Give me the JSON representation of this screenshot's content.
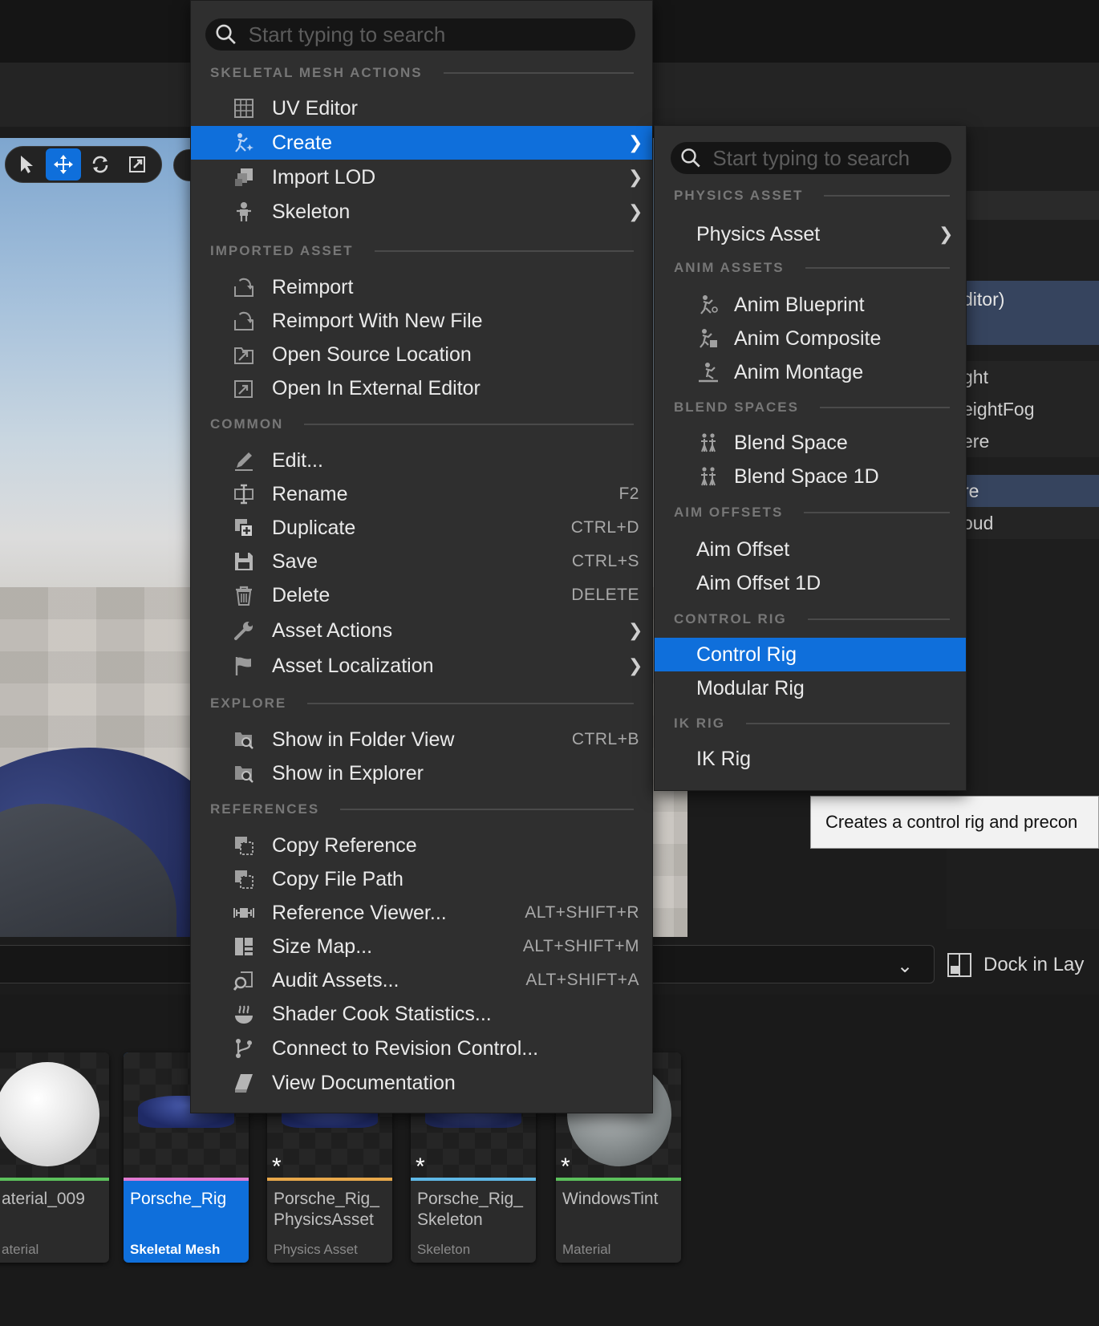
{
  "main_menu": {
    "search_placeholder": "Start typing to search",
    "sections": {
      "skeletal_mesh_actions": "SKELETAL MESH ACTIONS",
      "imported_asset": "IMPORTED ASSET",
      "common": "COMMON",
      "explore": "EXPLORE",
      "references": "REFERENCES"
    },
    "items": {
      "uv_editor": "UV Editor",
      "create": "Create",
      "import_lod": "Import LOD",
      "skeleton": "Skeleton",
      "reimport": "Reimport",
      "reimport_new_file": "Reimport With New File",
      "open_source_location": "Open Source Location",
      "open_external_editor": "Open In External Editor",
      "edit": "Edit...",
      "rename": "Rename",
      "duplicate": "Duplicate",
      "save": "Save",
      "delete": "Delete",
      "asset_actions": "Asset Actions",
      "asset_localization": "Asset Localization",
      "show_folder_view": "Show in Folder View",
      "show_explorer": "Show in Explorer",
      "copy_reference": "Copy Reference",
      "copy_file_path": "Copy File Path",
      "reference_viewer": "Reference Viewer...",
      "size_map": "Size Map...",
      "audit_assets": "Audit Assets...",
      "shader_cook_stats": "Shader Cook Statistics...",
      "connect_revision": "Connect to Revision Control...",
      "view_documentation": "View Documentation"
    },
    "shortcuts": {
      "rename": "F2",
      "duplicate": "CTRL+D",
      "save": "CTRL+S",
      "delete": "DELETE",
      "show_folder_view": "CTRL+B",
      "reference_viewer": "ALT+SHIFT+R",
      "size_map": "ALT+SHIFT+M",
      "audit_assets": "ALT+SHIFT+A"
    }
  },
  "create_submenu": {
    "search_placeholder": "Start typing to search",
    "sections": {
      "physics_asset": "PHYSICS ASSET",
      "anim_assets": "ANIM ASSETS",
      "blend_spaces": "BLEND SPACES",
      "aim_offsets": "AIM OFFSETS",
      "control_rig": "CONTROL RIG",
      "ik_rig": "IK RIG"
    },
    "items": {
      "physics_asset": "Physics Asset",
      "anim_blueprint": "Anim Blueprint",
      "anim_composite": "Anim Composite",
      "anim_montage": "Anim Montage",
      "blend_space": "Blend Space",
      "blend_space_1d": "Blend Space 1D",
      "aim_offset": "Aim Offset",
      "aim_offset_1d": "Aim Offset 1D",
      "control_rig": "Control Rig",
      "modular_rig": "Modular Rig",
      "ik_rig": "IK Rig"
    }
  },
  "tooltip": "Creates a control rig and precon",
  "outliner": {
    "rows": [
      "ditor)",
      "ght",
      "eightFog",
      "ere",
      "re",
      "oud"
    ]
  },
  "dock_label": "Dock in Lay",
  "assets": [
    {
      "name": "aterial_009",
      "type": "aterial"
    },
    {
      "name": "Porsche_Rig",
      "type": "Skeletal Mesh"
    },
    {
      "name": "Porsche_Rig_ PhysicsAsset",
      "type": "Physics Asset"
    },
    {
      "name": "Porsche_Rig_ Skeleton",
      "type": "Skeleton"
    },
    {
      "name": "WindowsTint",
      "type": "Material"
    }
  ],
  "colors": {
    "highlight": "#0f6fdb",
    "menu_bg": "#2f2f2f",
    "skeletal_mesh_bar": "#e07ad1",
    "physics_asset_bar": "#e8a84a",
    "skeleton_bar": "#5fb8e6",
    "material_bar": "#5cc15c"
  }
}
